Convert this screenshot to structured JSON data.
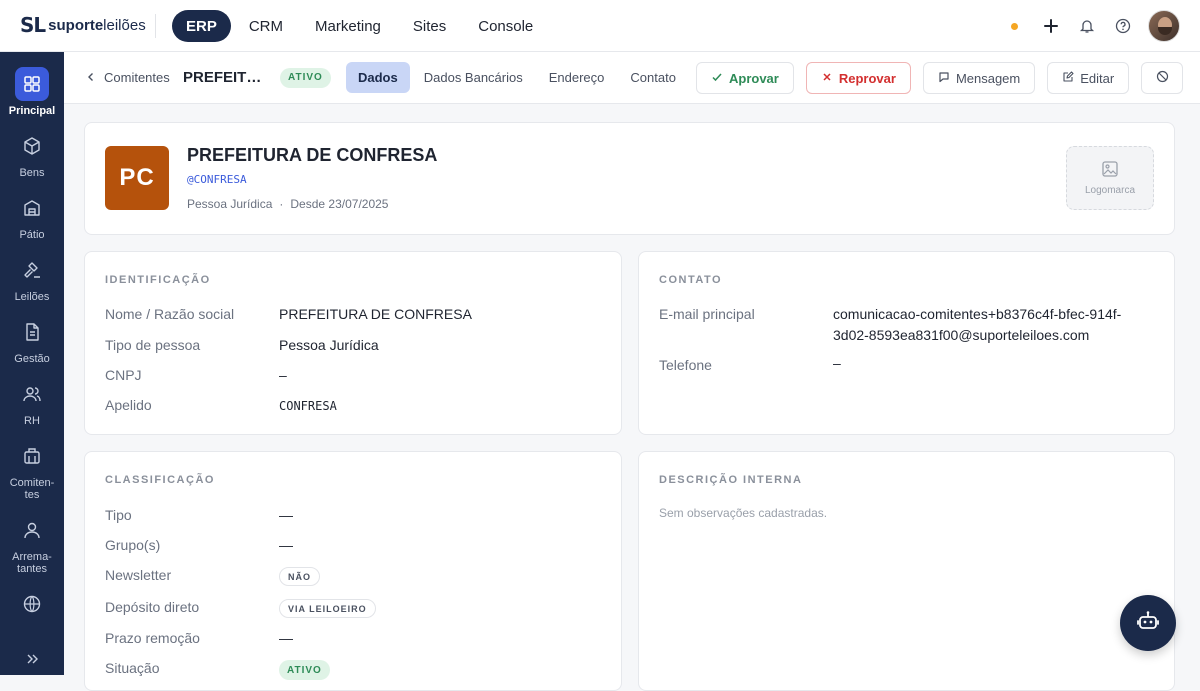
{
  "brand": {
    "mark": "SL",
    "word_bold": "suporte",
    "word_light": "leilões"
  },
  "nav": [
    {
      "label": "ERP",
      "active": true
    },
    {
      "label": "CRM"
    },
    {
      "label": "Marketing"
    },
    {
      "label": "Sites"
    },
    {
      "label": "Console"
    }
  ],
  "sidebar": [
    {
      "label": "Principal",
      "icon": "grid-icon",
      "active": true
    },
    {
      "label": "Bens",
      "icon": "box-icon"
    },
    {
      "label": "Pátio",
      "icon": "warehouse-icon"
    },
    {
      "label": "Leilões",
      "icon": "gavel-icon"
    },
    {
      "label": "Gestão",
      "icon": "document-icon"
    },
    {
      "label": "RH",
      "icon": "users-icon"
    },
    {
      "label": "Comiten-tes",
      "icon": "building-icon"
    },
    {
      "label": "Arrema-tantes",
      "icon": "user-icon"
    },
    {
      "label": "",
      "icon": "globe-icon"
    }
  ],
  "subbar": {
    "breadcrumb": "Comitentes",
    "title": "PREFEITURA DE CONFRESA",
    "status": "ATIVO",
    "tabs": [
      "Dados",
      "Dados Bancários",
      "Endereço",
      "Contato"
    ],
    "approve": "Aprovar",
    "reject": "Reprovar",
    "message": "Mensagem",
    "edit": "Editar"
  },
  "header": {
    "initials": "PC",
    "name": "PREFEITURA DE CONFRESA",
    "handle": "@CONFRESA",
    "type": "Pessoa Jurídica",
    "sep": "·",
    "since": "Desde 23/07/2025",
    "logo_label": "Logomarca"
  },
  "identificacao": {
    "title": "IDENTIFICAÇÃO",
    "rows": [
      {
        "label": "Nome / Razão social",
        "value": "PREFEITURA DE CONFRESA"
      },
      {
        "label": "Tipo de pessoa",
        "value": "Pessoa Jurídica"
      },
      {
        "label": "CNPJ",
        "value": "–"
      },
      {
        "label": "Apelido",
        "value": "CONFRESA"
      }
    ]
  },
  "contato": {
    "title": "CONTATO",
    "email_label": "E-mail principal",
    "email_line1": "comunicacao-comitentes+b8376c4f-bfec-914f-",
    "email_line2": "3d02-8593ea831f00@suporteleiloes.com",
    "phone_label": "Telefone",
    "phone_value": "–"
  },
  "classificacao": {
    "title": "CLASSIFICAÇÃO",
    "tipo_label": "Tipo",
    "tipo_value": "—",
    "grupo_label": "Grupo(s)",
    "grupo_value": "—",
    "news_label": "Newsletter",
    "news_value": "NÃO",
    "dep_label": "Depósito direto",
    "dep_value": "VIA LEILOEIRO",
    "prazo_label": "Prazo remoção",
    "prazo_value": "—",
    "sit_label": "Situação",
    "sit_value": "ATIVO"
  },
  "descricao": {
    "title": "DESCRIÇÃO INTERNA",
    "text": "Sem observações cadastradas."
  },
  "colors": {
    "navy": "#1b2a4a",
    "accent": "#3b5bdb",
    "orange": "#b5520c",
    "green": "#2e8b57",
    "red": "#d32f2f"
  }
}
